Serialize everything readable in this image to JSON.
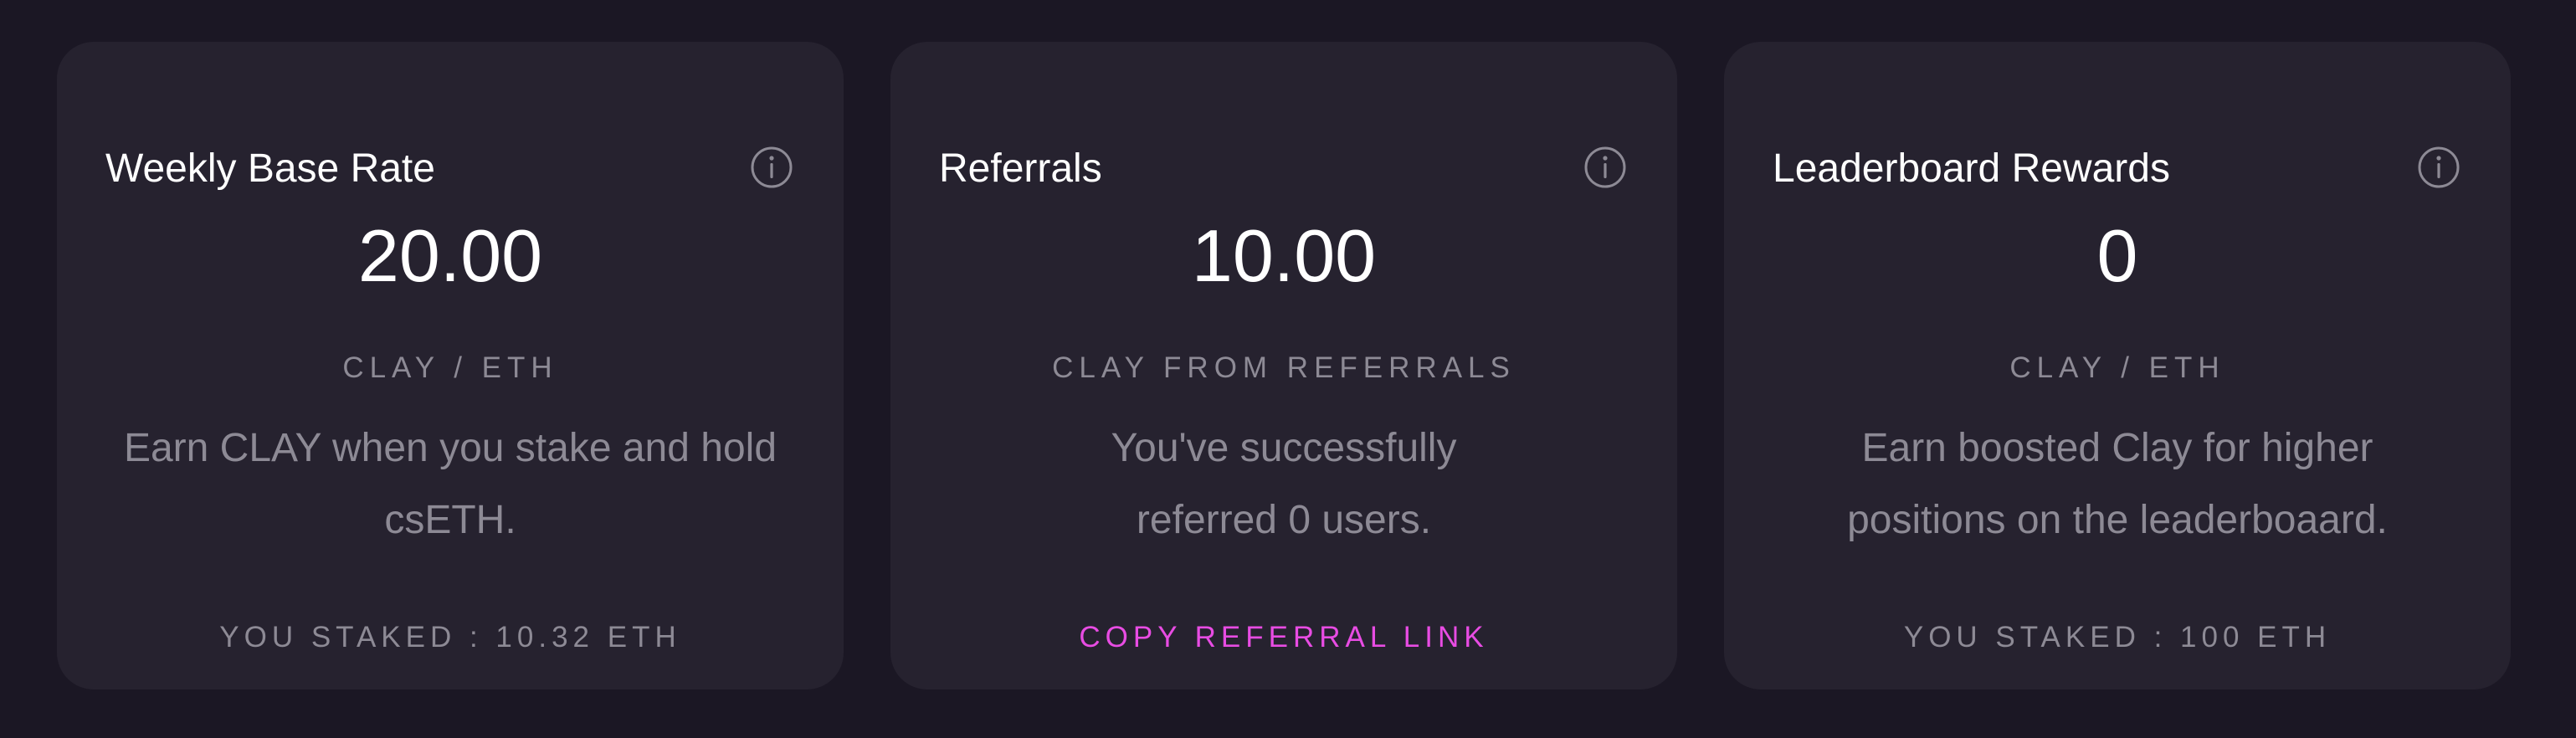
{
  "colors": {
    "page_background": "#1b1724",
    "card_background": "#26222f",
    "text_primary": "#ffffff",
    "text_muted": "#8d8a95",
    "accent": "#e84ce3"
  },
  "cards": [
    {
      "title": "Weekly Base Rate",
      "icon": "info-icon",
      "value": "20.00",
      "unit": "CLAY / ETH",
      "description_lines": [
        "Earn CLAY when you stake and hold",
        "csETH."
      ],
      "footer": "YOU STAKED : 10.32 ETH"
    },
    {
      "title": "Referrals",
      "icon": "info-icon",
      "value": "10.00",
      "unit": "CLAY FROM REFERRALS",
      "description_lines": [
        "You've successfully",
        "referred 0 users."
      ],
      "footer": "COPY REFERRAL LINK"
    },
    {
      "title": "Leaderboard Rewards",
      "icon": "info-icon",
      "value": "0",
      "unit": "CLAY / ETH",
      "description_lines": [
        "Earn boosted Clay for higher",
        "positions on the leaderboaard."
      ],
      "footer": "YOU STAKED : 100 ETH"
    }
  ]
}
